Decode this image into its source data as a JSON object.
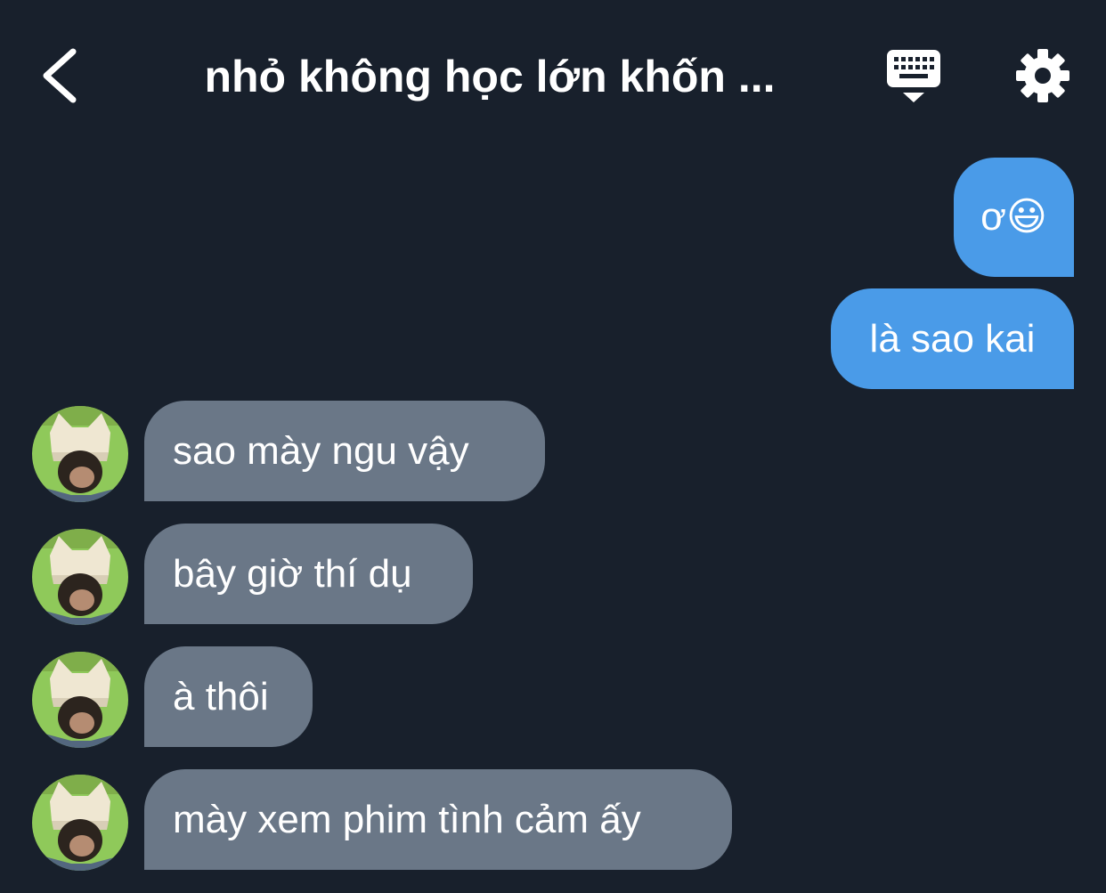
{
  "header": {
    "title": "nhỏ không học lớn khốn ..."
  },
  "messages": {
    "outgoing": [
      {
        "text": "ơ😃"
      },
      {
        "text": "là sao kai"
      }
    ],
    "incoming": [
      {
        "text": "sao mày ngu vậy"
      },
      {
        "text": "bây giờ thí dụ"
      },
      {
        "text": "à thôi"
      },
      {
        "text": "mày xem phim tình cảm ấy"
      }
    ]
  },
  "colors": {
    "background": "#18202c",
    "outgoing_bubble": "#4a9be8",
    "incoming_bubble": "#6a7787",
    "text": "#ffffff"
  },
  "icons": {
    "back": "chevron-left-icon",
    "keyboard": "keyboard-icon",
    "settings": "gear-icon"
  }
}
